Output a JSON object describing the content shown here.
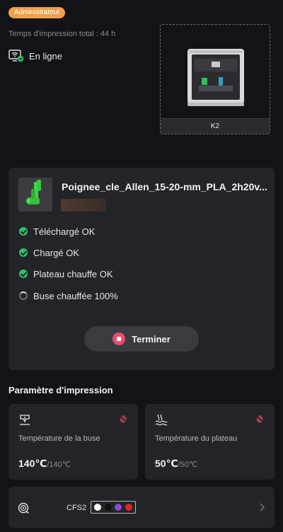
{
  "header": {
    "role_badge": "Administrateur",
    "print_time": "Temps d'impression total : 44 h",
    "status": "En ligne"
  },
  "printer": {
    "model": "K2"
  },
  "job": {
    "title": "Poignee_cle_Allen_15-20-mm_PLA_2h20v...",
    "steps": [
      {
        "label": "Téléchargé OK",
        "state": "done"
      },
      {
        "label": "Chargé OK",
        "state": "done"
      },
      {
        "label": "Plateau chauffe OK",
        "state": "done"
      },
      {
        "label": "Buse chauffée 100%",
        "state": "in-progress"
      }
    ],
    "finish_label": "Terminer"
  },
  "print_params": {
    "section_title": "Paramètre d'impression",
    "nozzle": {
      "label": "Température de la buse",
      "current": "140℃",
      "target": "/140℃"
    },
    "bed": {
      "label": "Température du plateau",
      "current": "50℃",
      "target": "/50℃"
    }
  },
  "cfs": {
    "label": "CFS2",
    "spools": [
      "#ffffff",
      "#111111",
      "#8a4bd8",
      "#e02424"
    ]
  },
  "colors": {
    "accent_orange": "#f0a04b",
    "ok_green": "#2fc06a",
    "stop_red": "#ea4d6a"
  }
}
